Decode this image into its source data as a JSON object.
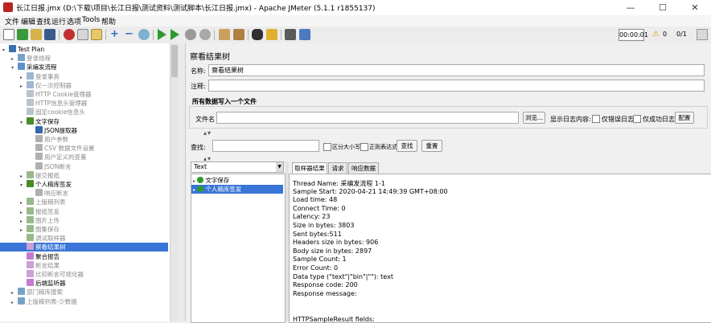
{
  "window": {
    "title": "长江日报.jmx (D:\\下载\\项目\\长江日报\\测试资料\\测试脚本\\长江日报.jmx) - Apache JMeter (5.1.1 r1855137)",
    "minimize": "—",
    "maximize": "☐",
    "close": "✕"
  },
  "menu": [
    "文件",
    "编辑",
    "查找",
    "运行",
    "选项",
    "Tools",
    "帮助"
  ],
  "toolbar": {
    "timer": "00:00:01",
    "warning_count": "0",
    "threads": "0/1"
  },
  "tree": [
    {
      "label": "Test Plan",
      "indent": 0,
      "exp": "▾",
      "color": "#3a6fb0",
      "selected": false,
      "disabled": false
    },
    {
      "label": "登录线程",
      "indent": 1,
      "exp": "▸",
      "color": "#7aa0c8",
      "selected": false,
      "disabled": true
    },
    {
      "label": "采编发流程",
      "indent": 1,
      "exp": "▾",
      "color": "#5b8fd0",
      "selected": false,
      "disabled": false
    },
    {
      "label": "登录事务",
      "indent": 2,
      "exp": "▸",
      "color": "#9fb7d4",
      "selected": false,
      "disabled": true
    },
    {
      "label": "仅一次控制器",
      "indent": 2,
      "exp": "▸",
      "color": "#9fb7d4",
      "selected": false,
      "disabled": true
    },
    {
      "label": "HTTP Cookie管理器",
      "indent": 2,
      "exp": "",
      "color": "#b9c4cf",
      "selected": false,
      "disabled": true
    },
    {
      "label": "HTTP信息头管理器",
      "indent": 2,
      "exp": "",
      "color": "#b9c4cf",
      "selected": false,
      "disabled": true
    },
    {
      "label": "固定cookie信息头",
      "indent": 2,
      "exp": "",
      "color": "#b9c4cf",
      "selected": false,
      "disabled": true
    },
    {
      "label": "文字保存",
      "indent": 2,
      "exp": "▾",
      "color": "#4a8a2a",
      "selected": false,
      "disabled": false
    },
    {
      "label": "JSON提取器",
      "indent": 3,
      "exp": "",
      "color": "#3366aa",
      "selected": false,
      "disabled": false
    },
    {
      "label": "用户参数",
      "indent": 3,
      "exp": "",
      "color": "#b0b0b0",
      "selected": false,
      "disabled": true
    },
    {
      "label": "CSV 数据文件设置",
      "indent": 3,
      "exp": "",
      "color": "#b0b0b0",
      "selected": false,
      "disabled": true
    },
    {
      "label": "用户定义的变量",
      "indent": 3,
      "exp": "",
      "color": "#b0b0b0",
      "selected": false,
      "disabled": true
    },
    {
      "label": "JSON断言",
      "indent": 3,
      "exp": "",
      "color": "#b0b0b0",
      "selected": false,
      "disabled": true
    },
    {
      "label": "提交报纸",
      "indent": 2,
      "exp": "▸",
      "color": "#9ab88a",
      "selected": false,
      "disabled": true
    },
    {
      "label": "个人稿库签发",
      "indent": 2,
      "exp": "▾",
      "color": "#4a8a2a",
      "selected": false,
      "disabled": false
    },
    {
      "label": "响应断言",
      "indent": 3,
      "exp": "",
      "color": "#b0b0b0",
      "selected": false,
      "disabled": true
    },
    {
      "label": "上版稿列表",
      "indent": 2,
      "exp": "▸",
      "color": "#9ab88a",
      "selected": false,
      "disabled": true
    },
    {
      "label": "报纸签发",
      "indent": 2,
      "exp": "▸",
      "color": "#9ab88a",
      "selected": false,
      "disabled": true
    },
    {
      "label": "图片上传",
      "indent": 2,
      "exp": "▸",
      "color": "#9ab88a",
      "selected": false,
      "disabled": true
    },
    {
      "label": "图集保存",
      "indent": 2,
      "exp": "▸",
      "color": "#9ab88a",
      "selected": false,
      "disabled": true
    },
    {
      "label": "调试取样器",
      "indent": 2,
      "exp": "",
      "color": "#9ab88a",
      "selected": false,
      "disabled": true
    },
    {
      "label": "察看结果树",
      "indent": 2,
      "exp": "",
      "color": "#c9a0d8",
      "selected": true,
      "disabled": false
    },
    {
      "label": "聚合报告",
      "indent": 2,
      "exp": "",
      "color": "#c47ad0",
      "selected": false,
      "disabled": false
    },
    {
      "label": "断言结果",
      "indent": 2,
      "exp": "",
      "color": "#c9a0d8",
      "selected": false,
      "disabled": true
    },
    {
      "label": "比较断言可视化器",
      "indent": 2,
      "exp": "",
      "color": "#c9a0d8",
      "selected": false,
      "disabled": true
    },
    {
      "label": "后端监听器",
      "indent": 2,
      "exp": "",
      "color": "#c47ad0",
      "selected": false,
      "disabled": false
    },
    {
      "label": "部门稿库搜索",
      "indent": 1,
      "exp": "▸",
      "color": "#7aa0c8",
      "selected": false,
      "disabled": true
    },
    {
      "label": "上版稿列表-少数据",
      "indent": 1,
      "exp": "▸",
      "color": "#7aa0c8",
      "selected": false,
      "disabled": true
    }
  ],
  "panel": {
    "title": "察看结果树",
    "name_label": "名称:",
    "name_value": "察看结果树",
    "comment_label": "注释:",
    "comment_value": "",
    "file_section_title": "所有数据写入一个文件",
    "filename_label": "文件名",
    "filename_value": "",
    "browse_button": "浏览...",
    "log_content_label": "显示日志内容:",
    "errors_only_label": "仅错误日志",
    "success_only_label": "仅成功日志",
    "config_button": "配置",
    "search_label": "查找:",
    "search_value": "",
    "case_sensitive_label": "区分大小写",
    "regex_label": "正则表达式",
    "search_button": "查找",
    "reset_button": "重置",
    "renderer_value": "Text",
    "samples": [
      {
        "label": "文字保存",
        "selected": false
      },
      {
        "label": "个人稿库签发",
        "selected": true
      }
    ],
    "tabs": [
      "取样器结果",
      "请求",
      "响应数据"
    ],
    "result_lines": [
      "Thread Name: 采编发流程 1-1",
      "Sample Start: 2020-04-21 14:49:39 GMT+08:00",
      "Load time: 48",
      "Connect Time: 0",
      "Latency: 23",
      "Size in bytes: 3803",
      "Sent bytes:511",
      "Headers size in bytes: 906",
      "Body size in bytes: 2897",
      "Sample Count: 1",
      "Error Count: 0",
      "Data type (\"text\"|\"bin\"|\"\"): text",
      "Response code: 200",
      "Response message:",
      "",
      "",
      "HTTPSampleResult fields:"
    ]
  }
}
